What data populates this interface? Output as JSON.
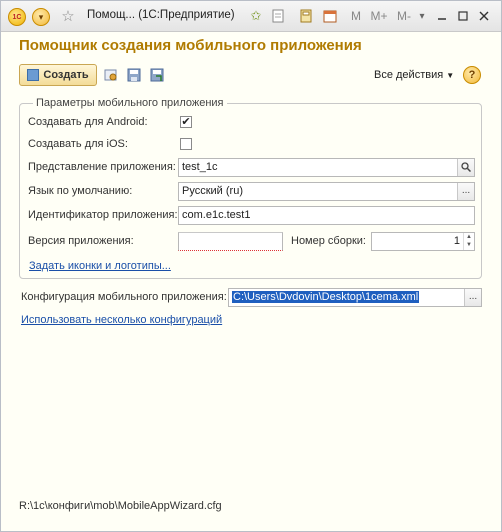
{
  "titlebar": {
    "logo": "1С",
    "title": "Помощ...  (1С:Предприятие)",
    "buttons": [
      "M",
      "M+",
      "M-"
    ],
    "icons": [
      "star-icon",
      "star-add-icon",
      "document-icon",
      "calculator-icon",
      "calendar-icon",
      "dropdown-icon",
      "minimize-icon",
      "maximize-icon",
      "close-icon"
    ]
  },
  "header": {
    "title": "Помощник создания мобильного приложения"
  },
  "toolbar": {
    "create_label": "Создать",
    "all_actions_label": "Все действия",
    "help_label": "?"
  },
  "params": {
    "group_title": "Параметры мобильного приложения",
    "android_label": "Создавать для Android:",
    "android_checked": "✔",
    "ios_label": "Создавать для iOS:",
    "ios_checked": "",
    "app_view_label": "Представление приложения:",
    "app_view_value": "test_1c",
    "language_label": "Язык по умолчанию:",
    "language_value": "Русский (ru)",
    "app_id_label": "Идентификатор приложения:",
    "app_id_value": "com.e1c.test1",
    "version_label": "Версия приложения:",
    "version_value": "",
    "build_label": "Номер сборки:",
    "build_value": "1",
    "icons_link": "Задать иконки и логотипы..."
  },
  "config": {
    "label": "Конфигурация мобильного приложения:",
    "value": "C:\\Users\\Dvdovin\\Desktop\\1cema.xml",
    "multi_link": "Использовать несколько конфигураций"
  },
  "status": {
    "path": "R:\\1c\\конфиги\\mob\\MobileAppWizard.cfg"
  },
  "colors": {
    "heading": "#b07b00",
    "link": "#1a4fa8",
    "selection": "#1f5fbf",
    "background": "#fffff6"
  }
}
